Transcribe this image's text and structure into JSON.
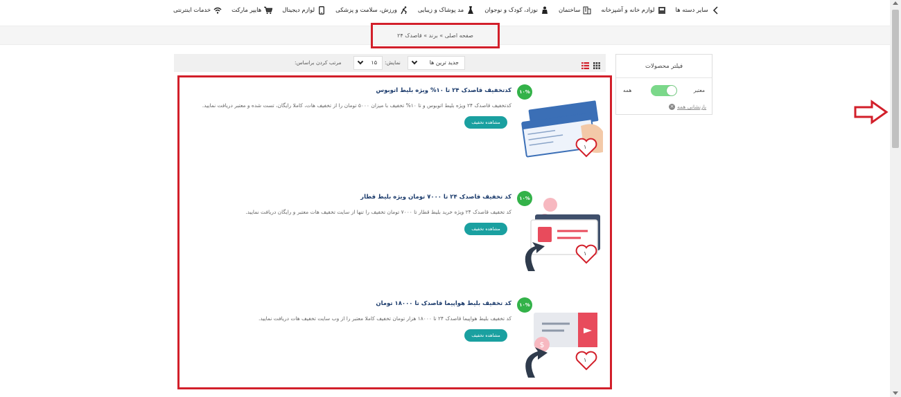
{
  "topnav": {
    "items": [
      {
        "label": "خدمات اینترنتی",
        "icon": "wifi-icon"
      },
      {
        "label": "هایپر مارکت",
        "icon": "cart-icon"
      },
      {
        "label": "لوازم دیجیتال",
        "icon": "mobile-icon"
      },
      {
        "label": "ورزش، سلامت و پزشکی",
        "icon": "runner-icon"
      },
      {
        "label": "مد پوشاک و زیبایی",
        "icon": "dress-icon"
      },
      {
        "label": "نوزاد، کودک و نوجوان",
        "icon": "baby-icon"
      },
      {
        "label": "ساختمان",
        "icon": "building-icon"
      },
      {
        "label": "لوازم خانه و آشپزخانه",
        "icon": "home-icon"
      },
      {
        "label": "سایر دسته ها",
        "icon": "chevron-left-icon"
      }
    ]
  },
  "breadcrumb": {
    "text": "صفحه اصلی » برند » قاصدک ۲۴"
  },
  "filter": {
    "title": "فیلتر محصولات",
    "valid_label": "معتبر",
    "all_label": "همه",
    "reset_label": "بازنشانی همه"
  },
  "sortbar": {
    "sort_label": "مرتب کردن براساس:",
    "sort_value": "جدید ترین ها",
    "show_label": "نمایش:",
    "show_value": "۱۵"
  },
  "products": [
    {
      "title": "کدتخفیف قاصدک ۲۴ تا ۱۰% ویژه بلیط اتوبوس",
      "description": "کدتخفیف قاصدک ۲۴ ویژه بلیط اتوبوس و تا ۱۰% تخفیف با میزان ۵۰۰۰ تومان را از تخفیف هات، کاملا رایگان، تست شده و معتبر دریافت نمایید.",
      "button": "مشاهده تخفیف",
      "badge": "۱۰%",
      "likes": "۱",
      "image": "bus-ticket-image"
    },
    {
      "title": "کد تخفیف قاصدک ۲۴ تا ۷۰۰۰ تومان ویژه بلیط قطار",
      "description": "کد تخفیف قاصدک ۲۴ ویژه خرید بلیط قطار تا ۷۰۰۰ تومان تخفیف را تنها از سایت تخفیف هات معتبر و رایگان دریافت نمایید.",
      "button": "مشاهده تخفیف",
      "badge": "۱۰%",
      "likes": "۱",
      "image": "train-ticket-image"
    },
    {
      "title": "کد تخفیف بلیط هواپیما قاصدک تا ۱۸۰۰۰ تومان",
      "description": "کد تخفیف بلیط هواپیما قاصدک ۲۴ تا ۱۸۰۰۰ هزار تومان تخفیف کاملا معتبر را از وب سایت تخفیف هات دریافت نمایید.",
      "button": "مشاهده تخفیف",
      "badge": "۱۰%",
      "likes": "۱",
      "image": "plane-ticket-image"
    }
  ],
  "colors": {
    "highlight": "#d21f2a",
    "button": "#1aa0a0",
    "badge": "#33b249",
    "toggle": "#7bd88a",
    "title": "#1a3a6b"
  }
}
